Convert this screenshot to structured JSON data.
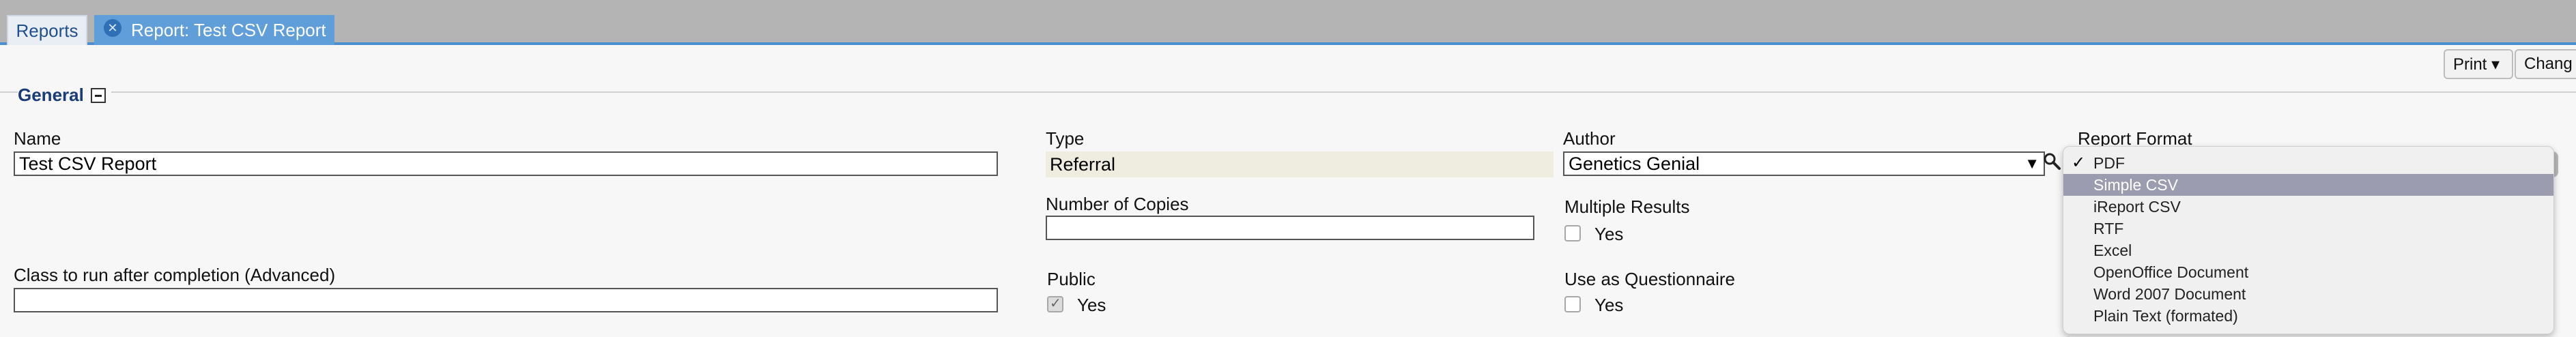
{
  "tabs": [
    {
      "label": "Reports"
    },
    {
      "label": "Report: Test CSV Report",
      "close_icon": "close-circle-icon"
    }
  ],
  "toolbar": {
    "print_label": "Print ▾",
    "change_label": "Chang"
  },
  "section": {
    "title": "General",
    "collapse_icon": "minus-box-icon"
  },
  "form": {
    "name": {
      "label": "Name",
      "value": "Test CSV Report"
    },
    "type": {
      "label": "Type",
      "value": "Referral"
    },
    "author": {
      "label": "Author",
      "value": "Genetics Genial",
      "search_icon": "search-icon"
    },
    "report_format": {
      "label": "Report Format",
      "selected": "PDF",
      "highlighted": "Simple CSV",
      "options": [
        "PDF",
        "Simple CSV",
        "iReport CSV",
        "RTF",
        "Excel",
        "OpenOffice Document",
        "Word 2007 Document",
        "Plain Text (formated)"
      ]
    },
    "copies": {
      "label": "Number of Copies",
      "value": ""
    },
    "multiple_results": {
      "label": "Multiple Results",
      "option": "Yes",
      "checked": false
    },
    "class_after": {
      "label": "Class to run after completion (Advanced)",
      "value": ""
    },
    "public": {
      "label": "Public",
      "option": "Yes",
      "checked": true
    },
    "questionnaire": {
      "label": "Use as Questionnaire",
      "option": "Yes",
      "checked": false
    }
  },
  "colors": {
    "tabbar": "#b4b4b4",
    "active_tab": "#5f9ed8",
    "accent_line": "#4b8fd0",
    "section_title": "#1a3c78",
    "readonly_bg": "#efece0",
    "highlight": "#9c9cb0"
  }
}
